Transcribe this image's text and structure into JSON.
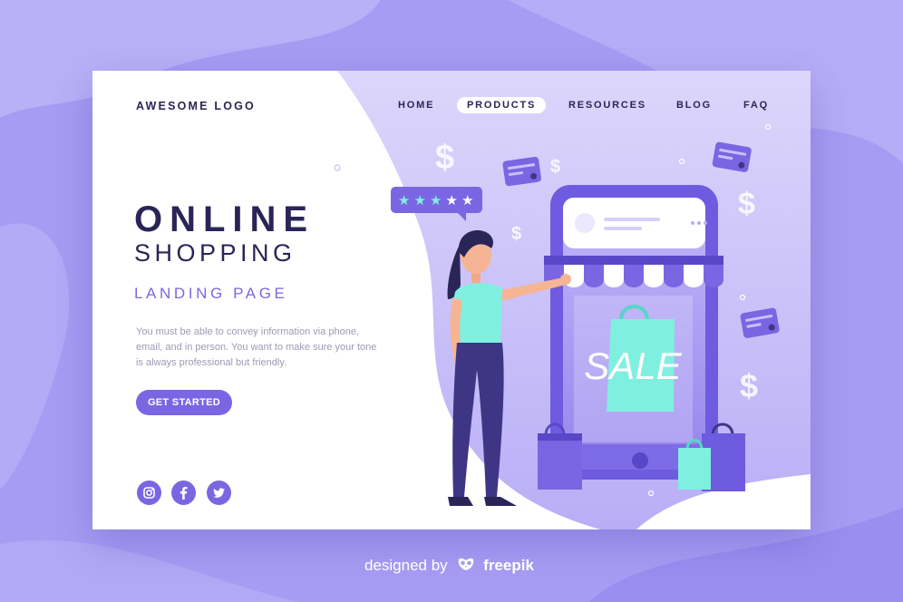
{
  "logo": "AWESOME LOGO",
  "nav": [
    {
      "label": "HOME",
      "active": false
    },
    {
      "label": "PRODUCTS",
      "active": true
    },
    {
      "label": "RESOURCES",
      "active": false
    },
    {
      "label": "BLOG",
      "active": false
    },
    {
      "label": "FAQ",
      "active": false
    }
  ],
  "hero": {
    "title_line1": "ONLINE",
    "title_line2": "SHOPPING",
    "subtitle": "LANDING PAGE",
    "description": "You must be able to convey information via phone, email, and in person. You want to make sure your tone is always professional but friendly.",
    "cta_label": "GET STARTED"
  },
  "social": [
    {
      "icon": "instagram-icon"
    },
    {
      "icon": "facebook-icon"
    },
    {
      "icon": "twitter-icon"
    }
  ],
  "illustration": {
    "sign_text": "SALE",
    "rating_stars": 5,
    "rating_filled": 3
  },
  "footer": {
    "prefix": "designed by",
    "brand": "freepik"
  },
  "colors": {
    "accent": "#7a66e2",
    "dark_text": "#2a2557",
    "background": "#a79cf3",
    "teal": "#7ff0e0"
  }
}
